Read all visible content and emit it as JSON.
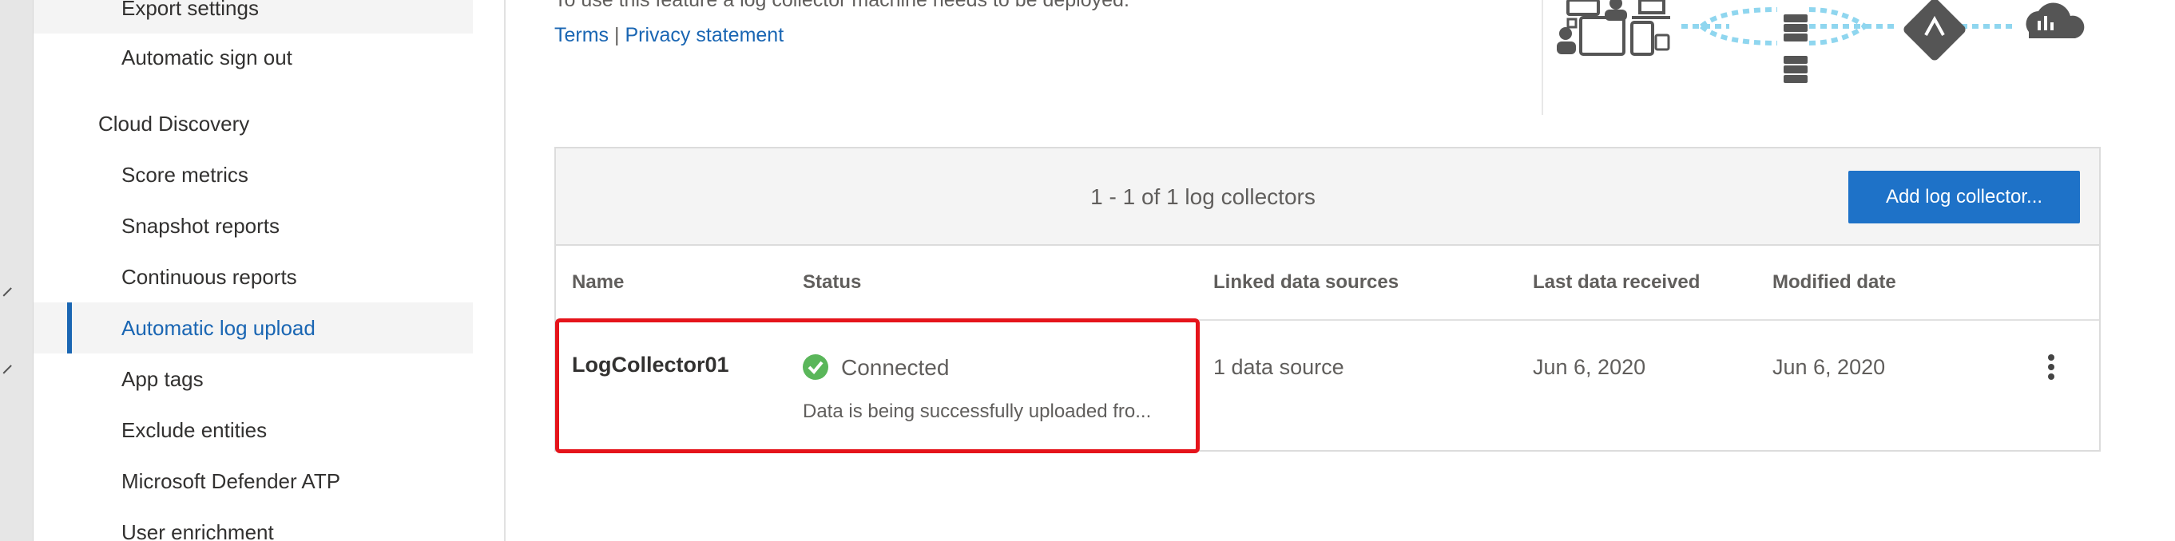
{
  "sidebar": {
    "items": [
      {
        "label": "Export settings",
        "type": "item"
      },
      {
        "label": "Automatic sign out",
        "type": "item"
      },
      {
        "label": "Cloud Discovery",
        "type": "header"
      },
      {
        "label": "Score metrics",
        "type": "item"
      },
      {
        "label": "Snapshot reports",
        "type": "item"
      },
      {
        "label": "Continuous reports",
        "type": "item"
      },
      {
        "label": "Automatic log upload",
        "type": "item",
        "selected": true
      },
      {
        "label": "App tags",
        "type": "item"
      },
      {
        "label": "Exclude entities",
        "type": "item"
      },
      {
        "label": "Microsoft Defender ATP",
        "type": "item"
      },
      {
        "label": "User enrichment",
        "type": "item"
      }
    ]
  },
  "main": {
    "intro_text": "To use this feature a log collector machine needs to be deployed.",
    "links": {
      "terms": "Terms",
      "separator": "|",
      "privacy": "Privacy statement"
    },
    "panel": {
      "count_text": "1 - 1 of 1 log collectors",
      "add_button": "Add log collector...",
      "columns": [
        "Name",
        "Status",
        "Linked data sources",
        "Last data received",
        "Modified date"
      ],
      "rows": [
        {
          "name": "LogCollector01",
          "status": "Connected",
          "status_detail": "Data is being successfully uploaded fro...",
          "linked_sources": "1 data source",
          "last_received": "Jun 6, 2020",
          "modified": "Jun 6, 2020"
        }
      ]
    }
  },
  "colors": {
    "accent": "#1a66b3",
    "button": "#1e72c8",
    "success": "#5ab65a",
    "highlight": "#e5141b"
  },
  "icons": {
    "status": "check-circle-icon",
    "row_menu": "more-vertical-icon"
  }
}
